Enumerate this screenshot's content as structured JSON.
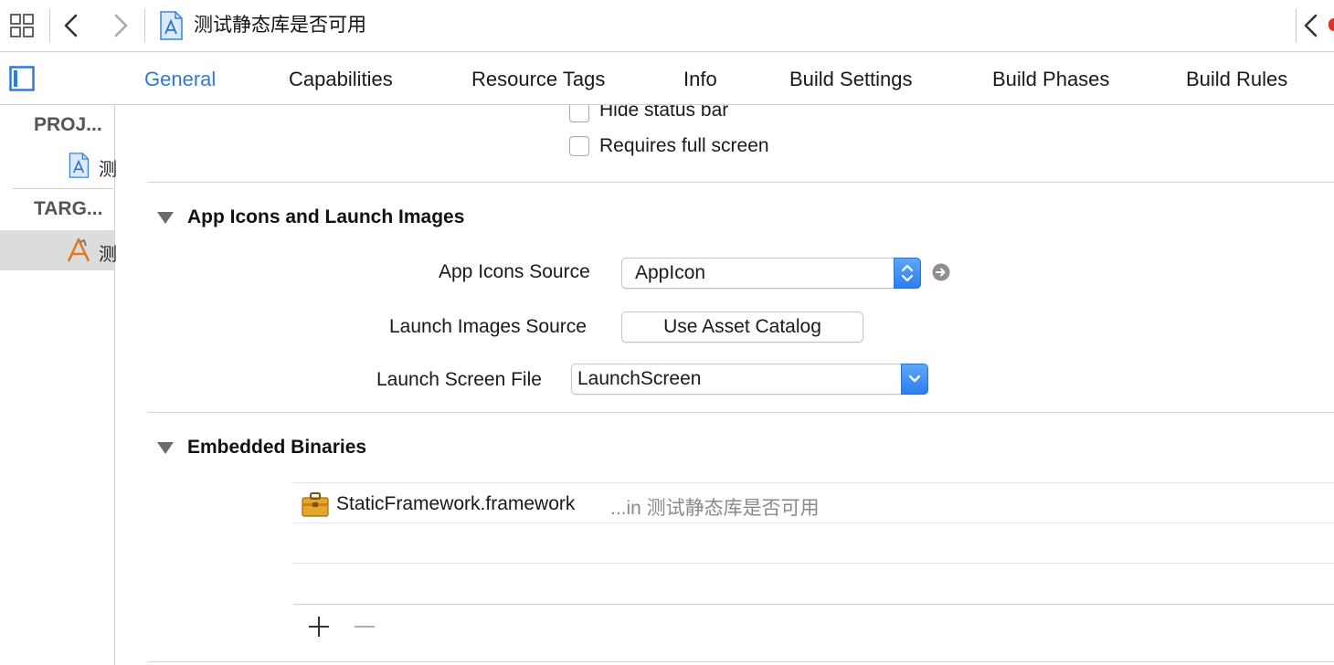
{
  "topbar": {
    "breadcrumb_title": "测试静态库是否可用",
    "icons": {
      "grid": "related-items-grid-icon",
      "back": "chevron-left-icon",
      "forward": "chevron-right-icon",
      "file": "xcodeproj-file-icon",
      "right_back": "chevron-left-icon"
    }
  },
  "tabs": [
    {
      "label": "General",
      "active": true
    },
    {
      "label": "Capabilities",
      "active": false
    },
    {
      "label": "Resource Tags",
      "active": false
    },
    {
      "label": "Info",
      "active": false
    },
    {
      "label": "Build Settings",
      "active": false
    },
    {
      "label": "Build Phases",
      "active": false
    },
    {
      "label": "Build Rules",
      "active": false
    }
  ],
  "sidebar": {
    "project_header": "PROJ...",
    "project_item": "测",
    "targets_header": "TARG...",
    "target_item": "测"
  },
  "deployment": {
    "hide_status_bar": {
      "label": "Hide status bar",
      "checked": false
    },
    "requires_full_screen": {
      "label": "Requires full screen",
      "checked": false
    }
  },
  "app_icons_section": {
    "title": "App Icons and Launch Images",
    "app_icons_source_label": "App Icons Source",
    "app_icons_source_value": "AppIcon",
    "launch_images_source_label": "Launch Images Source",
    "launch_images_button": "Use Asset Catalog",
    "launch_screen_file_label": "Launch Screen File",
    "launch_screen_file_value": "LaunchScreen"
  },
  "embedded_binaries": {
    "title": "Embedded Binaries",
    "items": [
      {
        "name": "StaticFramework.framework",
        "location": "...in 测试静态库是否可用"
      }
    ],
    "add_symbol": "+",
    "remove_symbol": "−"
  },
  "colors": {
    "accent": "#2e7bd6",
    "separator": "#cfcfcf",
    "selection": "#dcdcdc",
    "secondary_text": "#8a8a8a"
  }
}
